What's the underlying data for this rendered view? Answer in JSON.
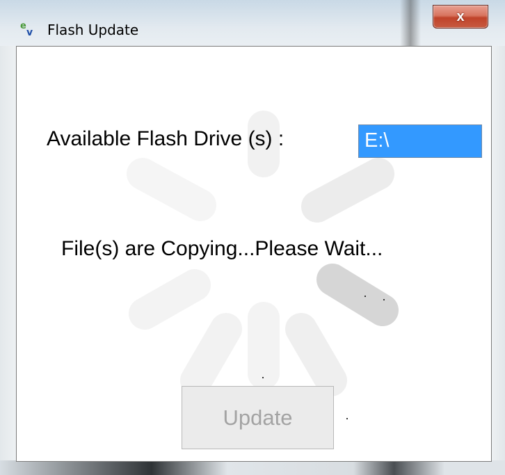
{
  "window": {
    "title": "Flash Update",
    "app_icon": "ev-logo-icon",
    "close_label": "x"
  },
  "drive": {
    "label": "Available Flash Drive (s) :",
    "value": "E:\\"
  },
  "status": {
    "message": "File(s) are Copying...Please Wait..."
  },
  "actions": {
    "update_label": "Update"
  },
  "spinner": {
    "icon": "loading-spinner-icon"
  },
  "colors": {
    "selection": "#3399ff",
    "close_button": "#c7503a",
    "disabled_text": "#a3a3a3"
  }
}
